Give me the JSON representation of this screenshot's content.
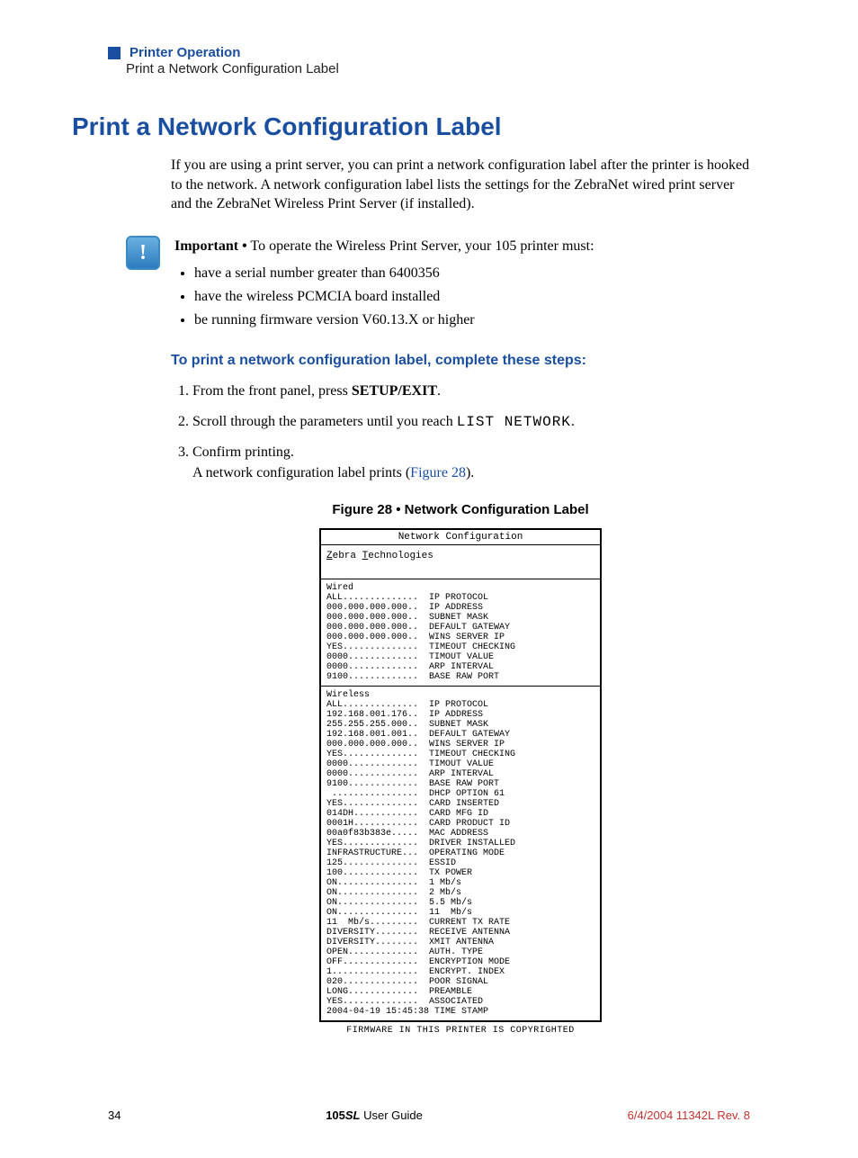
{
  "header": {
    "section": "Printer Operation",
    "subsection": "Print a Network Configuration Label"
  },
  "title": "Print a Network Configuration Label",
  "intro": "If you are using a print server, you can print a network configuration label after the printer is hooked to the network. A network configuration label lists the settings for the ZebraNet wired print server and the ZebraNet Wireless Print Server (if installed).",
  "important": {
    "label": "Important •",
    "lead": " To operate the Wireless Print Server, your 105    printer must:",
    "bullets": [
      "have a serial number greater than 6400356",
      "have the wireless PCMCIA board installed",
      "be running firmware version V60.13.X or higher"
    ]
  },
  "steps_heading": "To print a network configuration label, complete these steps:",
  "steps": {
    "s1a": "From the front panel, press ",
    "s1b": "SETUP/EXIT",
    "s1c": ".",
    "s2a": "Scroll through the parameters until you reach ",
    "s2b": "LIST NETWORK",
    "s2c": ".",
    "s3a": "Confirm printing.",
    "s3b": "A network configuration label prints (",
    "s3ref": "Figure 28",
    "s3c": ")."
  },
  "figure_caption": "Figure 28 • Network Configuration Label",
  "label": {
    "title": "Network Configuration",
    "company_u1": "Z",
    "company_t1": "ebra ",
    "company_u2": "T",
    "company_t2": "echnologies",
    "wired": "Wired\nALL..............  IP PROTOCOL\n000.000.000.000..  IP ADDRESS\n000.000.000.000..  SUBNET MASK\n000.000.000.000..  DEFAULT GATEWAY\n000.000.000.000..  WINS SERVER IP\nYES..............  TIMEOUT CHECKING\n0000.............  TIMOUT VALUE\n0000.............  ARP INTERVAL\n9100.............  BASE RAW PORT",
    "wireless": "Wireless\nALL..............  IP PROTOCOL\n192.168.001.176..  IP ADDRESS\n255.255.255.000..  SUBNET MASK\n192.168.001.001..  DEFAULT GATEWAY\n000.000.000.000..  WINS SERVER IP\nYES..............  TIMEOUT CHECKING\n0000.............  TIMOUT VALUE\n0000.............  ARP INTERVAL\n9100.............  BASE RAW PORT\n ................  DHCP OPTION 61\nYES..............  CARD INSERTED\n014DH............  CARD MFG ID\n0001H............  CARD PRODUCT ID\n00a0f83b383e.....  MAC ADDRESS\nYES..............  DRIVER INSTALLED\nINFRASTRUCTURE...  OPERATING MODE\n125..............  ESSID\n100..............  TX POWER\nON...............  1 Mb/s\nON...............  2 Mb/s\nON...............  5.5 Mb/s\nON...............  11  Mb/s\n11  Mb/s.........  CURRENT TX RATE\nDIVERSITY........  RECEIVE ANTENNA\nDIVERSITY........  XMIT ANTENNA\nOPEN.............  AUTH. TYPE\nOFF..............  ENCRYPTION MODE\n1................  ENCRYPT. INDEX\n020..............  POOR SIGNAL\nLONG.............  PREAMBLE\nYES..............  ASSOCIATED\n2004-04-19 15:45:38 TIME STAMP",
    "copyright": "FIRMWARE IN THIS PRINTER IS COPYRIGHTED"
  },
  "footer": {
    "page": "34",
    "center_a": "105",
    "center_b": "SL",
    "center_c": " User Guide",
    "right": "6/4/2004   11342L Rev. 8"
  }
}
